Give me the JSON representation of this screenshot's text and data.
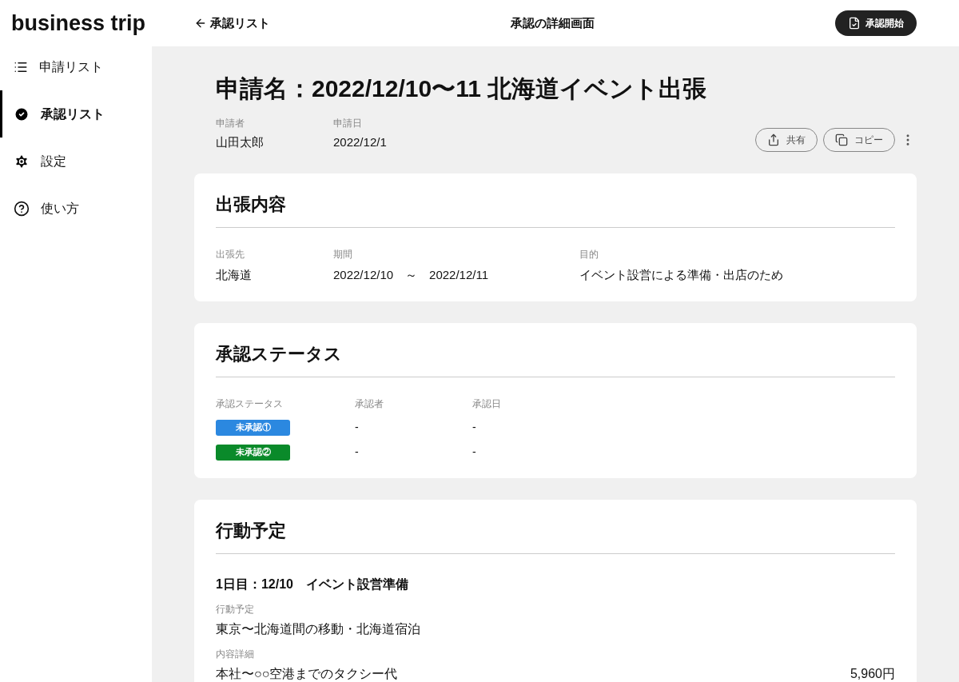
{
  "app_title": "business trip",
  "sidebar": {
    "items": [
      {
        "label": "申請リスト",
        "kind": "list",
        "selected": false
      },
      {
        "label": "承認リスト",
        "kind": "check",
        "selected": true
      },
      {
        "label": "設定",
        "kind": "gear",
        "selected": false
      },
      {
        "label": "使い方",
        "kind": "help",
        "selected": false
      }
    ]
  },
  "header": {
    "back_link": "承認リスト",
    "title": "承認の詳細画面",
    "primary_button": "承認開始"
  },
  "application": {
    "title": "申請名：2022/12/10〜11 北海道イベント出張",
    "fields": [
      {
        "label": "申請者",
        "value": "山田太郎"
      },
      {
        "label": "申請日",
        "value": "2022/12/1"
      }
    ],
    "actions": [
      {
        "label": "共有",
        "kind": "share"
      },
      {
        "label": "コピー",
        "kind": "copy"
      }
    ]
  },
  "trip_details": {
    "heading": "出張内容",
    "fields": [
      {
        "label": "出張先",
        "value": "北海道"
      },
      {
        "label": "期間",
        "value": "2022/12/10　～　2022/12/11"
      },
      {
        "label": "目的",
        "value": "イベント設営による準備・出店のため"
      }
    ]
  },
  "approval_status": {
    "heading": "承認ステータス",
    "columns": [
      "承認ステータス",
      "承認者",
      "承認日"
    ],
    "rows": [
      {
        "status": "未承認①",
        "color": "#2b88e0",
        "approver": "-",
        "date": "-"
      },
      {
        "status": "未承認②",
        "color": "#0a8a2a",
        "approver": "-",
        "date": "-"
      }
    ]
  },
  "schedule": {
    "heading": "行動予定",
    "days": [
      {
        "title": "1日目：12/10　イベント設営準備",
        "plan_label": "行動予定",
        "plan": "東京〜北海道間の移動・北海道宿泊",
        "detail_label": "内容詳細",
        "expenses": [
          {
            "item": "本社〜○○空港までのタクシー代",
            "amount": "5,960円"
          }
        ]
      }
    ]
  }
}
